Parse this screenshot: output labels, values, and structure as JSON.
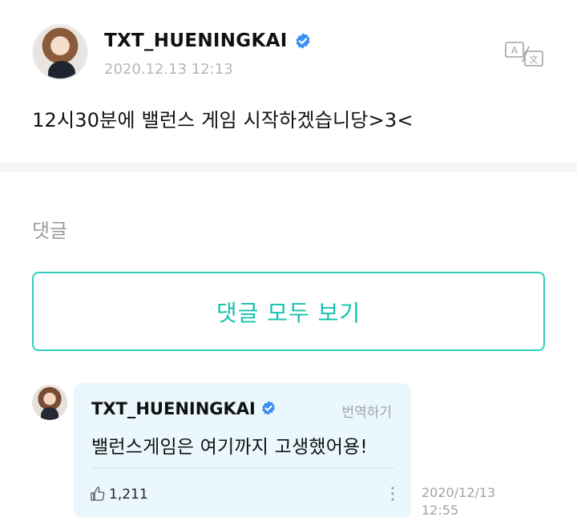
{
  "post": {
    "username": "TXT_HUENINGKAI",
    "timestamp": "2020.12.13 12:13",
    "body": "12시30분에 밸런스 게임 시작하겠습니당>3<",
    "verified_icon": "verified-badge-icon",
    "translate_icon": "translate-icon"
  },
  "comments_section": {
    "label": "댓글",
    "view_all_label": "댓글 모두 보기"
  },
  "comment": {
    "username": "TXT_HUENINGKAI",
    "translate_label": "번역하기",
    "text": "밸런스게임은 여기까지 고생했어용!",
    "like_count": "1,211",
    "date_line1": "2020/12/13",
    "date_line2": "12:55",
    "like_icon": "thumbs-up-icon",
    "more_icon": "more-vertical-icon"
  },
  "colors": {
    "accent": "#15c2ad",
    "verified": "#3a8ff0",
    "bubble": "#eaf7fd"
  }
}
